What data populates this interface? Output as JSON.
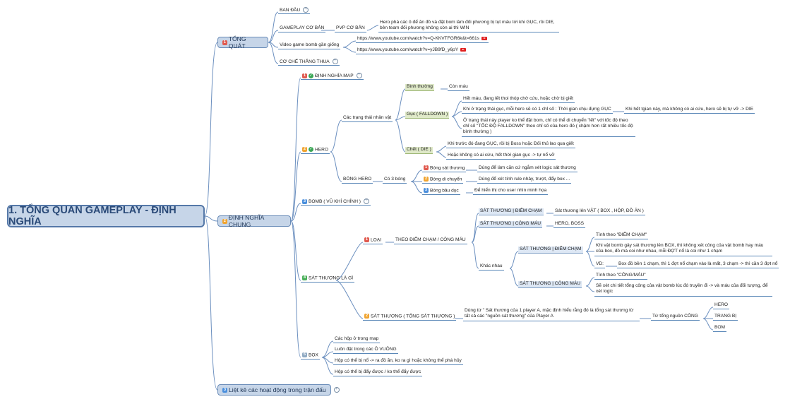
{
  "root": "1. TỔNG QUAN GAMEPLAY - ĐỊNH NGHĨA",
  "sections": {
    "tong_quat": {
      "num": "1",
      "label": "TỔNG QUÁT"
    },
    "dinh_nghia_chung": {
      "num": "2",
      "label": "ĐỊNH NGHĨA CHUNG"
    },
    "liet_ke": {
      "num": "3",
      "label": "Liệt kê các hoạt động trong trận đấu"
    }
  },
  "tong_quat": {
    "ban_dau": "BAN ĐẦU",
    "gameplay_co_ban": "GAMEPLAY CƠ BẢN",
    "pvp_co_ban": "PVP CƠ BẢN",
    "pvp_desc": "Hero phá các ô để ăn đồ và đặt bom làm đối phương bị tụt máu tới khi GỤC, rồi DIE, bên team đối phương không còn ai thì WIN",
    "video_label": "Video game bomb gần giống",
    "link1": "https://www.youtube.com/watch?v=Q-KKVTFGR6k&t=661s",
    "link2": "https://www.youtube.com/watch?v=yJB9fD_y6pY",
    "co_che": "CƠ CHẾ THẮNG THUA"
  },
  "dinh_nghia": {
    "map": {
      "num": "1",
      "label": "ĐỊNH NGHĨA MAP"
    },
    "hero": {
      "num": "2",
      "label": "HERO"
    },
    "cac_trang_thai": "Các trạng thái nhân vật",
    "binh_thuong": "Bình thường",
    "con_mau": "Còn máu",
    "guc": "Gục ( FALLDOWN )",
    "guc_1": "Hết máu, đang lết thoi thóp chờ cứu, hoặc chờ bị giết",
    "guc_2": "Khi ở trạng thái gục, mỗi hero sẽ có 1 chỉ số : Thời gian chịu đựng GỤC",
    "guc_2b": "Khi hết tgian này, mà không có ai cứu, hero sẽ bị tự vỡ -> DIE",
    "guc_3": "Ở trạng thái này player ko thể đặt bom, chỉ có thể di chuyển \"lết\" với tốc độ theo chỉ số \"TỐC ĐỘ FALLDOWN\" theo chỉ số của hero đó ( chậm hơn rất nhiều tốc độ bình thường )",
    "chet": "Chết ( DIE )",
    "chet_1": "Khi trước đó đang GỤC, rồi bị Boss hoặc Đối thủ lao qua giết",
    "chet_2": "Hoặc không có ai cứu, hết thời gian gục -> tự nổ vỡ",
    "bong_hero": "BÓNG HERO",
    "co_3_bong": "Có 3 bóng",
    "bong_st": {
      "num": "1",
      "label": "Bóng sát thương",
      "desc": "Dùng để làm căn cứ ngắm xét logic sát thương"
    },
    "bong_dc": {
      "num": "2",
      "label": "Bóng di chuyển",
      "desc": "Dùng để xét tính rule nhảy, trượt, đẩy box ..."
    },
    "bong_bd": {
      "num": "3",
      "label": "Bóng bầu dục",
      "desc": "Để hiển thị cho user nhìn minh họa"
    },
    "bomb": {
      "num": "3",
      "label": "BOMB ( VŨ KHÍ CHÍNH )"
    },
    "sat_thuong": {
      "num": "4",
      "label": "SÁT THƯƠNG LÀ GÌ"
    },
    "loai": {
      "num": "1",
      "label": "LOẠI"
    },
    "theo_diem": "THEO ĐIỂM CHẠM / CÔNG MÁU",
    "st_diem_cham": "SÁT THƯƠNG | ĐIỂM CHẠM",
    "st_diem_cham_desc": "Sát thương lên VẬT ( BOX , HỘP, ĐỒ ĂN )",
    "st_cong_mau": "SÁT THƯƠNG | CÔNG MÁU",
    "st_cong_mau_desc": "HERO, BOSS",
    "khac_nhau": "Khác nhau",
    "kn_diem_cham": "SÁT THƯƠNG | ĐIỂM CHẠM",
    "tinh_theo_dc": "Tính theo \"ĐIỂM CHẠM\"",
    "dc_desc": "Khi vật bomb gây sát thương lên BOX, thì không xét công của vật bomb hay máu của box, đồ mà coi như nhau, mỗi ĐỢT nổ là coi như 1 chạm",
    "vd": "VD:",
    "vd_desc": "Box đồ bền 1 chạm, thì 1 đợt nổ chạm vào là mất, 3 chạm -> thì cần 3 đợt nổ",
    "kn_cong_mau": "SÁT THƯƠNG | CÔNG MÁU",
    "tinh_theo_cm": "Tính theo \"CÔNG/MÁU\"",
    "cm_desc": "Sẽ xét chi tiết tổng công của vật bomb lúc đó truyền đi -> và máu của đối tượng, để xét logic",
    "st_tong": {
      "num": "2",
      "label": "SÁT THƯƠNG ( TỔNG SÁT THƯƠNG )"
    },
    "st_tong_desc": "Dùng từ \" Sát thương của 1 player A, mặc định hiểu rằng đó là tổng sát thương từ tất cả các \"nguồn sát thương\" của Player A",
    "tu_tong": "Từ tổng nguồn CÔNG",
    "hero_src": "HERO",
    "trang_bi": "TRANG BỊ",
    "bom_src": "BOM",
    "box": {
      "num": "5",
      "label": "BOX"
    },
    "box_1": "Các hộp ở trong map",
    "box_2": "Luôn đặt trong các Ô VUÔNG",
    "box_3": "Hộp có thể bị nổ -> ra đồ ăn, ko ra gì hoặc không thể phá hủy",
    "box_4": "Hộp có thể bị đẩy được / ko thể đẩy được"
  }
}
